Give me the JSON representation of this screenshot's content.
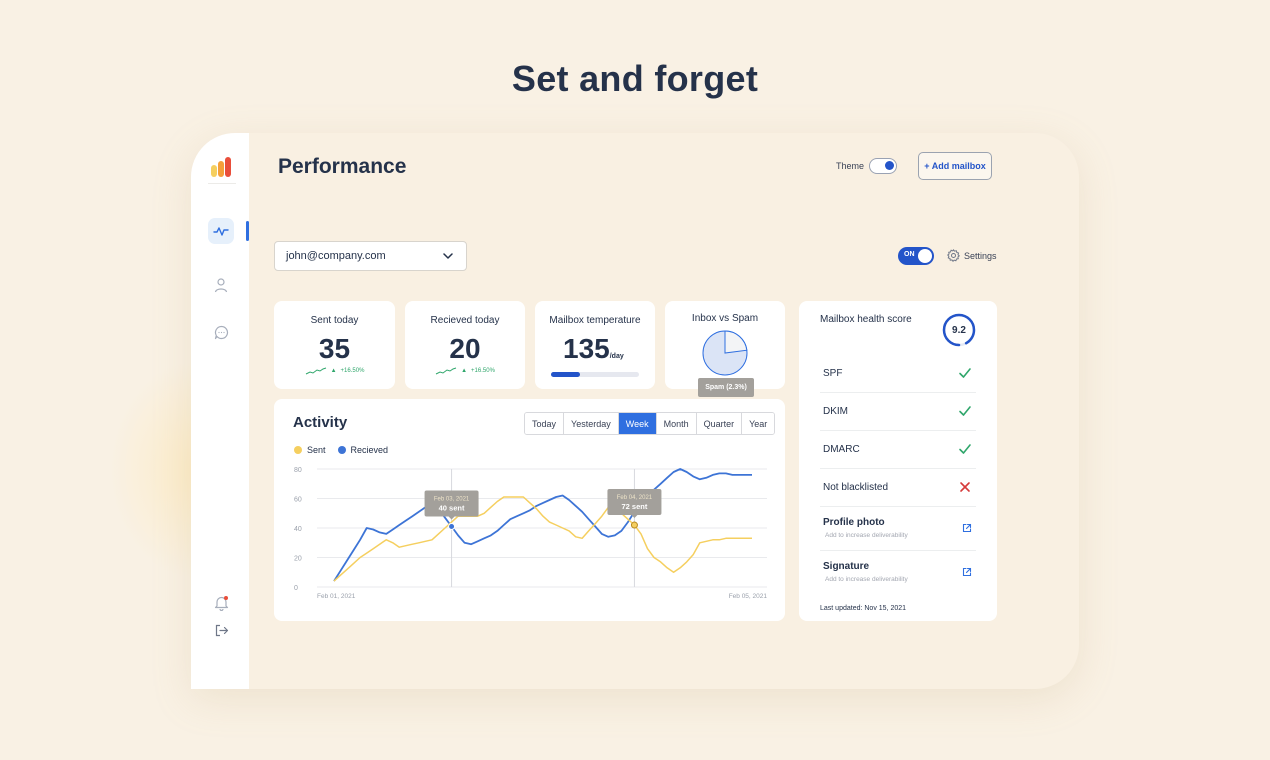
{
  "headline": "Set and forget",
  "colors": {
    "accent": "#2f6fe0",
    "brand_dark": "#25324a",
    "sent": "#f5cf5f",
    "received": "#3d74d6",
    "success": "#2fa66b",
    "danger": "#d63b3b"
  },
  "sidebar": {
    "logo_icon": "bar-logo-icon",
    "items": [
      "activity-icon",
      "user-icon",
      "chat-icon"
    ],
    "bottom": [
      "bell-icon",
      "logout-icon"
    ]
  },
  "header": {
    "title": "Performance",
    "theme_label": "Theme",
    "add_mailbox": "+ Add mailbox"
  },
  "toolbar": {
    "mailbox": "john@company.com",
    "toggle_label": "ON",
    "settings_label": "Settings"
  },
  "stats": [
    {
      "label": "Sent today",
      "value": "35",
      "trend": "+16.50%"
    },
    {
      "label": "Recieved today",
      "value": "20",
      "trend": "+16.50%"
    },
    {
      "label": "Mailbox temperature",
      "value": "135",
      "unit": "/day",
      "progress": 0.33
    },
    {
      "label": "Inbox vs Spam",
      "tooltip": "Spam (2.3%)",
      "spam_fraction": 0.23
    }
  ],
  "activity": {
    "title": "Activity",
    "tabs": [
      "Today",
      "Yesterday",
      "Week",
      "Month",
      "Quarter",
      "Year"
    ],
    "active_tab": "Week",
    "legend": [
      "Sent",
      "Recieved"
    ],
    "tooltips": [
      {
        "date": "Feb 03, 2021",
        "text": "40 sent"
      },
      {
        "date": "Feb 04, 2021",
        "text": "72 sent"
      }
    ]
  },
  "chart_data": {
    "type": "line",
    "x_range": [
      "Feb 01, 2021",
      "Feb 05, 2021"
    ],
    "x_tick_labels": [
      "Feb 01, 2021",
      "Feb 05, 2021"
    ],
    "x": [
      0,
      0.25,
      0.5,
      0.75,
      1,
      1.25,
      1.5,
      1.75,
      2,
      2.25,
      2.5,
      2.75,
      3,
      3.25,
      3.5,
      3.75,
      4,
      4.25,
      4.5,
      4.75,
      5,
      5.25,
      5.5,
      5.75,
      6,
      6.25,
      6.5,
      6.75,
      7,
      7.25,
      7.5,
      7.75,
      8,
      8.25,
      8.5,
      8.75,
      9,
      9.25,
      9.5,
      9.75,
      10,
      10.25,
      10.5,
      10.75,
      11,
      11.25,
      11.5,
      11.75,
      12,
      12.25,
      12.5,
      12.75,
      13,
      13.25,
      13.5,
      13.75,
      14,
      14.25,
      14.5,
      14.75,
      15,
      15.25,
      15.5,
      15.75,
      16
    ],
    "series": [
      {
        "name": "Sent",
        "values": [
          4,
          8,
          12,
          16,
          20,
          23,
          26,
          29,
          32,
          30,
          27,
          28,
          29,
          30,
          31,
          32,
          36,
          40,
          44,
          48,
          48,
          48,
          48,
          50,
          54,
          58,
          61,
          61,
          61,
          61,
          57,
          53,
          48,
          44,
          42,
          40,
          38,
          34,
          33,
          38,
          43,
          48,
          54,
          52,
          50,
          46,
          42,
          36,
          26,
          20,
          17,
          13,
          10,
          13,
          17,
          22,
          30,
          31,
          32,
          32,
          33,
          33,
          33,
          33,
          33
        ],
        "highlight": {
          "x": 11.5,
          "label": "Feb 04, 2021"
        }
      },
      {
        "name": "Recieved",
        "values": [
          4,
          11,
          18,
          25,
          32,
          40,
          39,
          37,
          36,
          39,
          42,
          45,
          48,
          51,
          54,
          56,
          53,
          47,
          41,
          35,
          30,
          29,
          31,
          33,
          35,
          38,
          42,
          46,
          48,
          50,
          52,
          55,
          57,
          59,
          61,
          62,
          59,
          55,
          51,
          46,
          41,
          36,
          34,
          35,
          38,
          44,
          51,
          57,
          62,
          66,
          70,
          74,
          78,
          80,
          78,
          75,
          73,
          74,
          76,
          77,
          77,
          76,
          76,
          76,
          76
        ],
        "highlight": {
          "x": 4.5,
          "label": "Feb 03, 2021"
        }
      }
    ],
    "ylim": [
      0,
      80
    ],
    "y_ticks": [
      0,
      20,
      40,
      60,
      80
    ],
    "grid": true,
    "legend": "top-left"
  },
  "health": {
    "title": "Mailbox health score",
    "score": "9.2",
    "score_fraction": 0.92,
    "checks": [
      {
        "name": "SPF",
        "status": "pass"
      },
      {
        "name": "DKIM",
        "status": "pass"
      },
      {
        "name": "DMARC",
        "status": "pass"
      },
      {
        "name": "Not blacklisted",
        "status": "fail"
      }
    ],
    "extras": [
      {
        "name": "Profile photo",
        "sub": "Add to increase deliverability"
      },
      {
        "name": "Signature",
        "sub": "Add to increase deliverability"
      }
    ],
    "updated": "Last updated: Nov 15, 2021"
  }
}
